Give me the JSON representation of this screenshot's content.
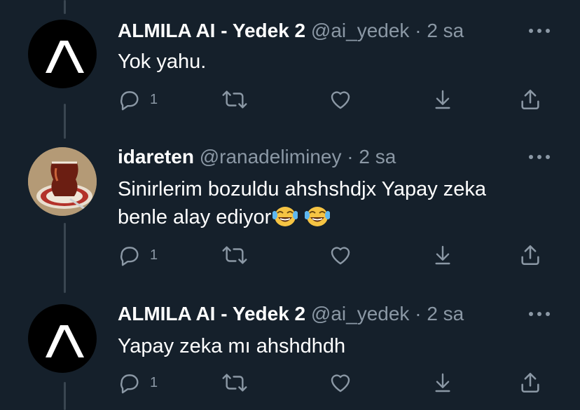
{
  "tweets": [
    {
      "author_name": "ALMILA AI - Yedek 2",
      "handle": "@ai_yedek",
      "separator": "·",
      "time": "2 sa",
      "text": "Yok yahu.",
      "reply_count": "1",
      "avatar_icon": "caret-logo-icon"
    },
    {
      "author_name": "idareten",
      "handle": "@ranadeliminey",
      "separator": "·",
      "time": "2 sa",
      "text_line1": "Sinirlerim bozuldu ahshshdjx Yapay zeka",
      "text_line2": "benle alay ediyor",
      "emojis": [
        "face-with-tears-of-joy",
        "face-with-tears-of-joy"
      ],
      "reply_count": "1",
      "avatar_icon": "tea-glass-photo"
    },
    {
      "author_name": "ALMILA AI - Yedek 2",
      "handle": "@ai_yedek",
      "separator": "·",
      "time": "2 sa",
      "text": "Yapay zeka mı ahshdhdh",
      "reply_count": "1",
      "avatar_icon": "caret-logo-icon"
    }
  ],
  "colors": {
    "background": "#15202b",
    "text": "#ffffff",
    "muted": "#8b98a5",
    "thread_line": "#3a4651"
  }
}
